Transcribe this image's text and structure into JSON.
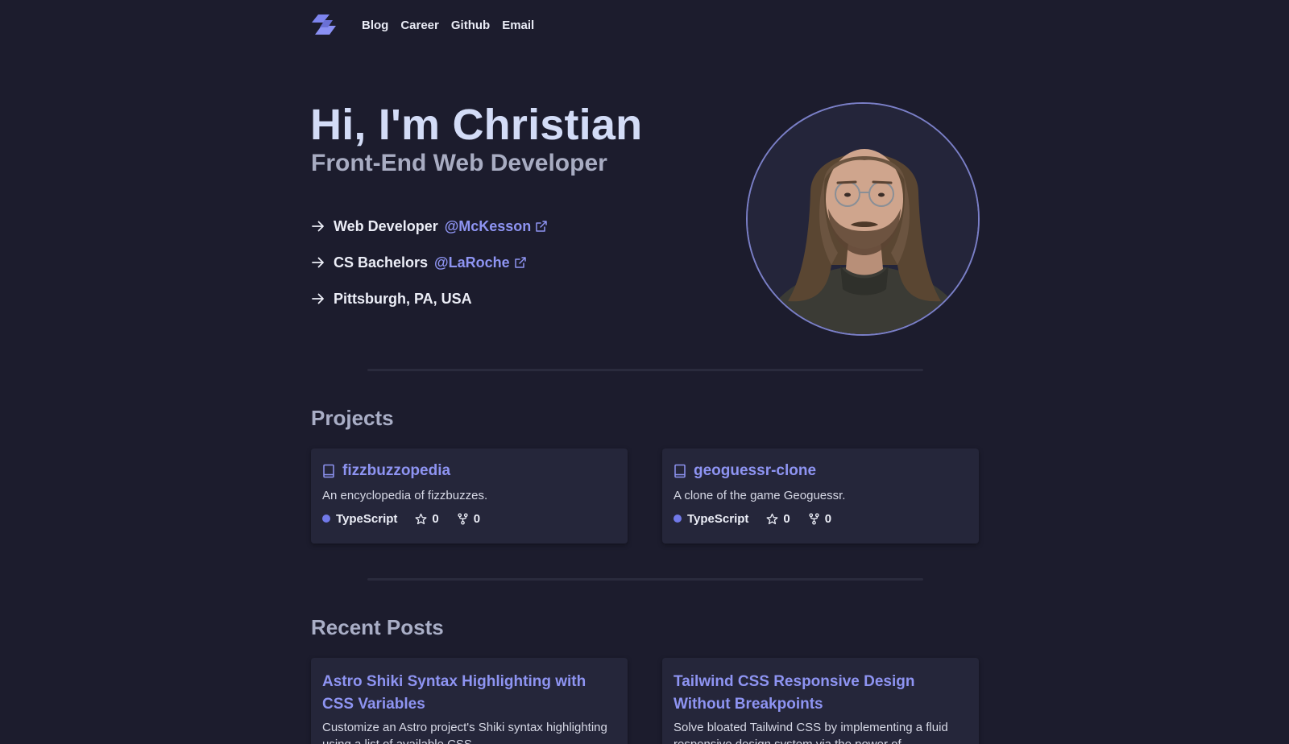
{
  "nav": {
    "links": [
      "Blog",
      "Career",
      "Github",
      "Email"
    ]
  },
  "hero": {
    "title": "Hi, I'm Christian",
    "subtitle": "Front-End Web Developer",
    "facts": [
      {
        "text": "Web Developer",
        "link": "@McKesson"
      },
      {
        "text": "CS Bachelors",
        "link": "@LaRoche"
      },
      {
        "text": "Pittsburgh, PA, USA",
        "link": null
      }
    ]
  },
  "projects": {
    "title": "Projects",
    "items": [
      {
        "name": "fizzbuzzopedia",
        "description": "An encyclopedia of fizzbuzzes.",
        "language": "TypeScript",
        "stars": "0",
        "forks": "0"
      },
      {
        "name": "geoguessr-clone",
        "description": "A clone of the game Geoguessr.",
        "language": "TypeScript",
        "stars": "0",
        "forks": "0"
      }
    ]
  },
  "posts": {
    "title": "Recent Posts",
    "items": [
      {
        "title": "Astro Shiki Syntax Highlighting with CSS Variables",
        "excerpt": "Customize an Astro project's Shiki syntax highlighting using a list of available CSS"
      },
      {
        "title": "Tailwind CSS Responsive Design Without Breakpoints",
        "excerpt": "Solve bloated Tailwind CSS by implementing a fluid responsive design system via the power of"
      }
    ]
  },
  "colors": {
    "background": "#1c1c2d",
    "accent": "#8e94f2",
    "card": "#25263a",
    "language_dot": "#7179e9"
  },
  "icons": [
    "logo-icon",
    "arrow-right-icon",
    "external-link-icon",
    "repo-book-icon",
    "star-icon",
    "fork-icon"
  ]
}
